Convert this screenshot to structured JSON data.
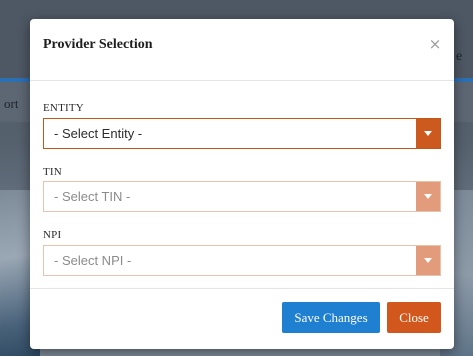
{
  "background": {
    "nav_fragment": "ort",
    "topbar_fragment": "e"
  },
  "modal": {
    "title": "Provider Selection",
    "close_glyph": "×",
    "fields": [
      {
        "label": "ENTITY",
        "selected": "- Select Entity -",
        "state": "active"
      },
      {
        "label": "TIN",
        "selected": "- Select TIN -",
        "state": "disabled"
      },
      {
        "label": "NPI",
        "selected": "- Select NPI -",
        "state": "disabled"
      }
    ],
    "footer": {
      "save_label": "Save Changes",
      "close_label": "Close"
    }
  },
  "colors": {
    "primary_button": "#1f7fd0",
    "close_button": "#d2571d",
    "select_accent": "#cc5a1f"
  },
  "icons": {
    "close": "close-icon",
    "dropdown": "chevron-down-icon"
  }
}
